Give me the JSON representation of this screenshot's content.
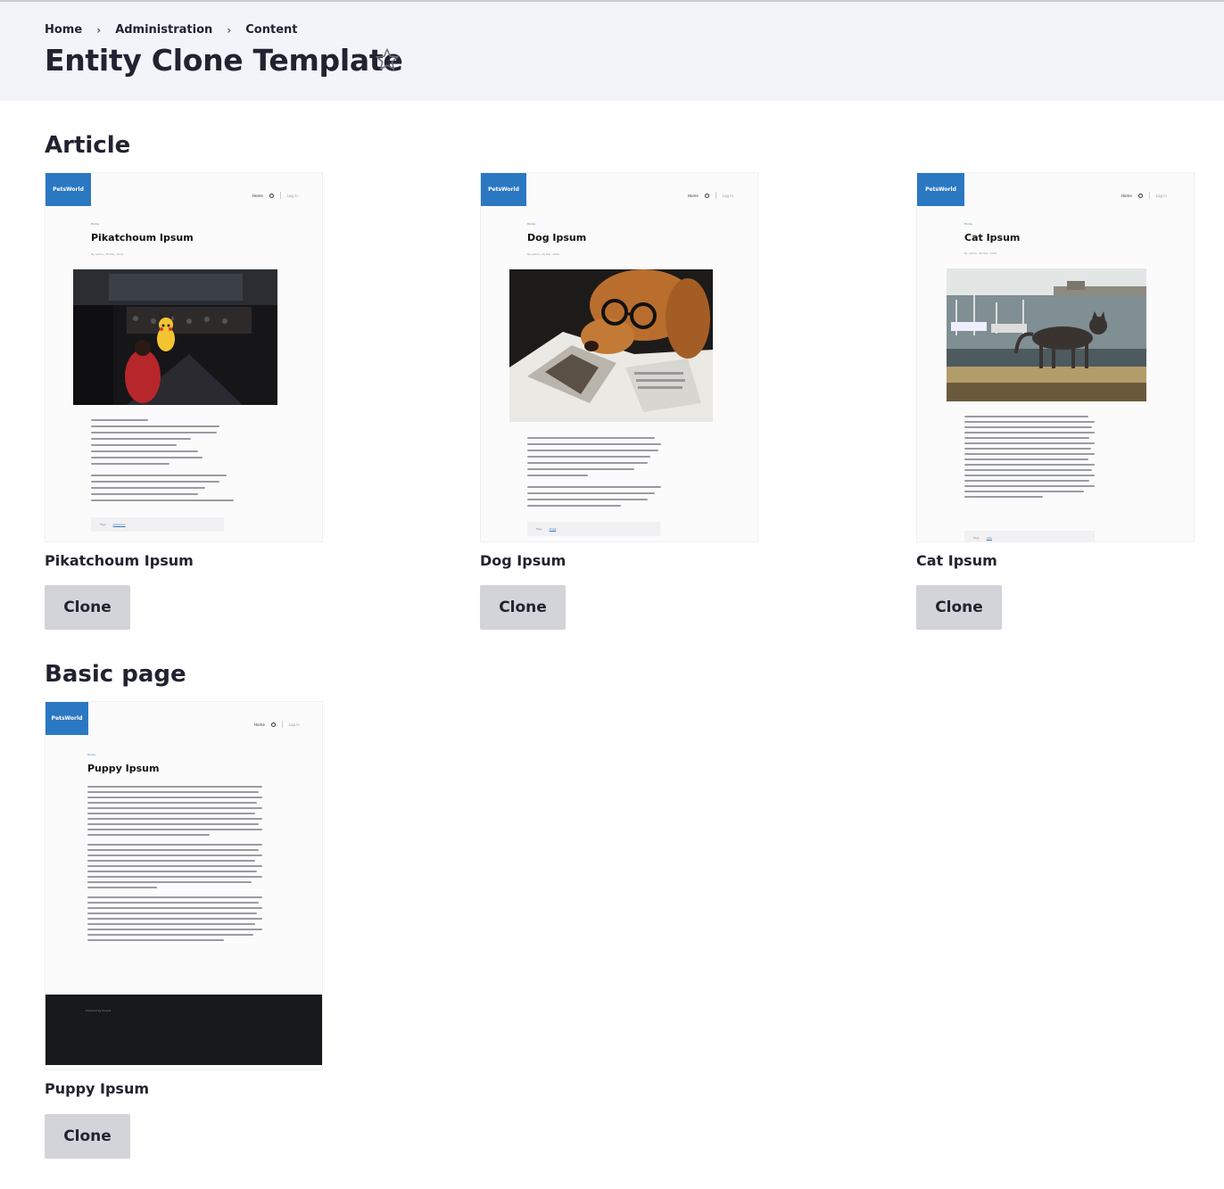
{
  "breadcrumb": {
    "items": [
      "Home",
      "Administration",
      "Content"
    ],
    "separator": "›"
  },
  "page_title": "Entity Clone Template",
  "sections": {
    "article": {
      "title": "Article",
      "cards": [
        {
          "label": "Pikatchoum Ipsum",
          "clone_label": "Clone",
          "preview": {
            "logo": "PetsWorld",
            "nav_home": "Home",
            "nav_login": "Log in",
            "crumb": "Home",
            "title": "Pikatchoum Ipsum",
            "meta": "By admin, 28 Mar, 2022",
            "tags_label": "Tags",
            "tag": "pokemon",
            "image": "pikachu-event-photo"
          }
        },
        {
          "label": "Dog Ipsum",
          "clone_label": "Clone",
          "preview": {
            "logo": "PetsWorld",
            "nav_home": "Home",
            "nav_login": "Log in",
            "crumb": "Home",
            "title": "Dog Ipsum",
            "meta": "By admin, 28 Mar, 2022",
            "tags_label": "Tags",
            "tag": "Dogs",
            "image": "dog-with-glasses-reading-magazine"
          }
        },
        {
          "label": "Cat Ipsum",
          "clone_label": "Clone",
          "preview": {
            "logo": "PetsWorld",
            "nav_home": "Home",
            "nav_login": "Log in",
            "crumb": "Home",
            "title": "Cat Ipsum",
            "meta": "By admin, 28 Mar, 2022",
            "tags_label": "Tags",
            "tag": "cats",
            "image": "cat-walking-on-harbor-wall"
          }
        }
      ]
    },
    "basic_page": {
      "title": "Basic page",
      "cards": [
        {
          "label": "Puppy Ipsum",
          "clone_label": "Clone",
          "preview": {
            "logo": "PetsWorld",
            "nav_home": "Home",
            "nav_login": "Log in",
            "crumb": "Home",
            "title": "Puppy Ipsum",
            "footer_text": "Powered by Drupal"
          }
        }
      ]
    }
  },
  "colors": {
    "header_bg": "#f3f4f9",
    "button_bg": "#d3d4d9",
    "text": "#222330",
    "logo_blue": "#2b78c2"
  },
  "icons": {
    "favorite": "star-outline-icon",
    "separator": "chevron-right-icon"
  }
}
